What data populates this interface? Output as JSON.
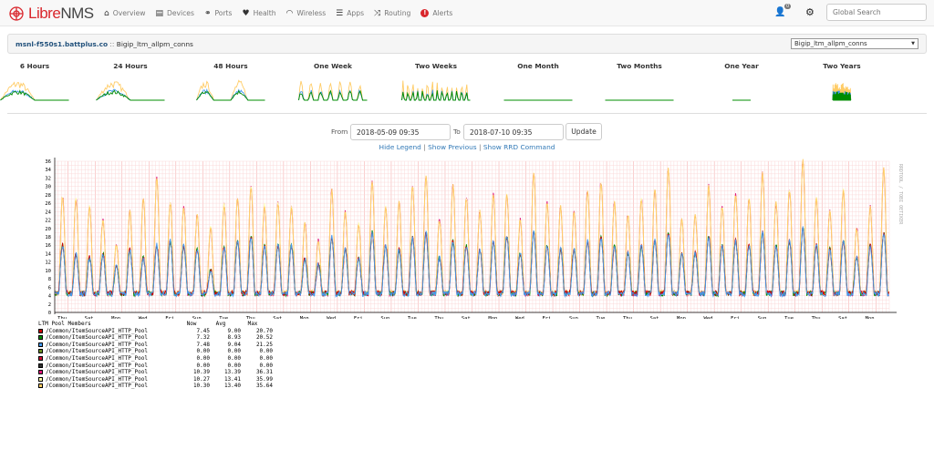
{
  "nav": {
    "brand_a": "Libre",
    "brand_b": "NMS",
    "items": [
      {
        "label": "Overview",
        "icon": "home-icon",
        "glyph": "⌂"
      },
      {
        "label": "Devices",
        "icon": "server-icon",
        "glyph": "▤"
      },
      {
        "label": "Ports",
        "icon": "link-icon",
        "glyph": "⚭"
      },
      {
        "label": "Health",
        "icon": "heartbeat-icon",
        "glyph": "♥"
      },
      {
        "label": "Wireless",
        "icon": "wifi-icon",
        "glyph": "◠"
      },
      {
        "label": "Apps",
        "icon": "tasks-icon",
        "glyph": "☰"
      },
      {
        "label": "Routing",
        "icon": "random-icon",
        "glyph": "⤨"
      },
      {
        "label": "Alerts",
        "icon": "exclamation-circle-icon",
        "glyph": "!"
      }
    ],
    "notification_count": "0",
    "search_placeholder": "Global Search"
  },
  "header": {
    "device": "msnl-f550s1.battplus.co",
    "separator": " :: ",
    "graph": "Bigip_ltm_allpm_conns",
    "select_value": "Bigip_ltm_allpm_conns"
  },
  "thumbnails": [
    "6 Hours",
    "24 Hours",
    "48 Hours",
    "One Week",
    "Two Weeks",
    "One Month",
    "Two Months",
    "One Year",
    "Two Years"
  ],
  "range": {
    "from_label": "From",
    "from_value": "2018-05-09 09:35",
    "to_label": "To",
    "to_value": "2018-07-10 09:35",
    "update": "Update"
  },
  "links": {
    "hide_legend": "Hide Legend",
    "show_previous": "Show Previous",
    "show_rrd": "Show RRD Command",
    "sep": "|"
  },
  "watermark": "RRDTOOL / TOBI OETIKER",
  "chart_data": {
    "type": "line",
    "ylim": [
      0,
      36
    ],
    "yticks": [
      0,
      2,
      4,
      6,
      8,
      10,
      12,
      14,
      16,
      18,
      20,
      22,
      24,
      26,
      28,
      30,
      32,
      34,
      36
    ],
    "grid": true,
    "xticks": [
      "Thu",
      "Sat",
      "Mon",
      "Wed",
      "Fri",
      "Sun",
      "Tue",
      "Thu",
      "Sat",
      "Mon",
      "Wed",
      "Fri",
      "Sun",
      "Tue",
      "Thu",
      "Sat",
      "Mon",
      "Wed",
      "Fri",
      "Sun",
      "Tue",
      "Thu",
      "Sat",
      "Mon",
      "Wed",
      "Fri",
      "Sun",
      "Tue",
      "Thu",
      "Sat",
      "Mon"
    ],
    "daily_peak_high": [
      27.5,
      27,
      25,
      22,
      16,
      24,
      27,
      32,
      26,
      25,
      23,
      20,
      25.5,
      27,
      30,
      25.5,
      26,
      25,
      21,
      17,
      29,
      24,
      21,
      31,
      25,
      26,
      30,
      32,
      22,
      30,
      27,
      24,
      28,
      28,
      22,
      33,
      26,
      25,
      24,
      29,
      31,
      26,
      23,
      27,
      29,
      34,
      22,
      23,
      30,
      25,
      28,
      27,
      33,
      26,
      29,
      36,
      27,
      24,
      29,
      20,
      25,
      34
    ],
    "daily_peak_low": [
      16,
      14,
      13,
      14,
      11,
      15,
      13,
      16,
      17,
      16,
      15,
      10,
      15.5,
      17,
      18,
      16,
      16,
      16,
      13,
      11.5,
      18,
      15,
      13,
      19,
      16,
      15,
      18,
      19,
      13,
      17,
      16,
      15,
      17,
      18,
      14,
      19,
      16,
      15,
      15,
      17,
      18,
      16,
      14,
      16,
      17,
      19,
      14,
      14,
      18,
      16,
      17,
      16,
      19,
      16,
      17,
      20,
      16,
      15,
      17,
      13,
      16,
      19
    ],
    "legend": {
      "header": "LTM Pool Members",
      "columns": [
        "Now",
        "Avg",
        "Max"
      ],
      "series": [
        {
          "name": "/Common/ItemSourceAPI_HTTP_Pool",
          "color": "#cc0000",
          "now": "7.45",
          "avg": "9.00",
          "max": "20.70"
        },
        {
          "name": "/Common/ItemSourceAPI_HTTP_Pool",
          "color": "#008c00",
          "now": "7.32",
          "avg": "8.93",
          "max": "20.52"
        },
        {
          "name": "/Common/ItemSourceAPI_HTTP_Pool",
          "color": "#4499ee",
          "now": "7.48",
          "avg": "9.04",
          "max": "21.25"
        },
        {
          "name": "/Common/ItemSourceAPI_HTTP_Pool",
          "color": "#6b8e23",
          "now": "0.00",
          "avg": "0.00",
          "max": "0.00"
        },
        {
          "name": "/Common/ItemSourceAPI_HTTP_Pool",
          "color": "#cc1133",
          "now": "0.00",
          "avg": "0.00",
          "max": "0.00"
        },
        {
          "name": "/Common/ItemSourceAPI_HTTP_Pool",
          "color": "#333333",
          "now": "0.00",
          "avg": "0.00",
          "max": "0.00"
        },
        {
          "name": "/Common/ItemSourceAPI_HTTP_Pool",
          "color": "#e0147c",
          "now": "10.39",
          "avg": "13.39",
          "max": "36.31"
        },
        {
          "name": "/Common/ItemSourceAPI_HTTP_Pool",
          "color": "#ffffaa",
          "now": "10.27",
          "avg": "13.41",
          "max": "35.99"
        },
        {
          "name": "/Common/ItemSourceAPI_HTTP_Pool",
          "color": "#ffcc66",
          "now": "10.30",
          "avg": "13.40",
          "max": "35.64"
        }
      ]
    }
  }
}
